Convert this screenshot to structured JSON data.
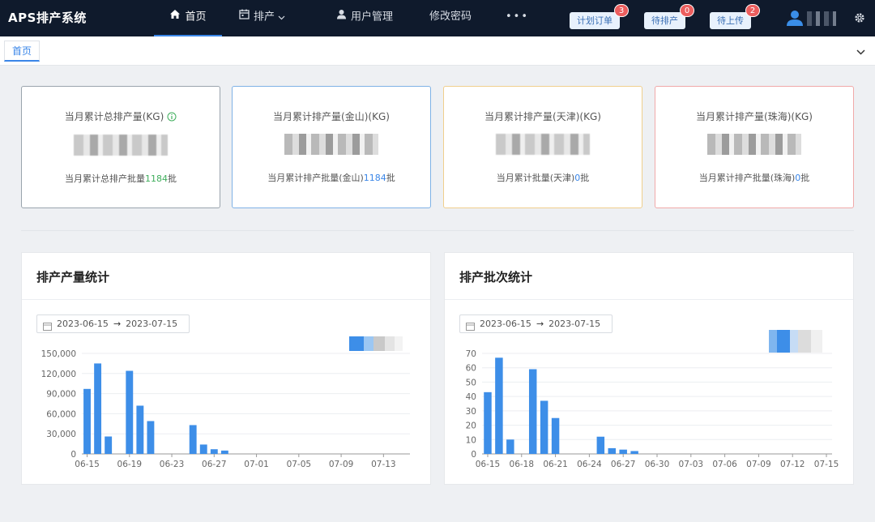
{
  "app": {
    "title": "APS排产系统",
    "nav": [
      {
        "label": "首页",
        "icon": "home-icon",
        "active": true
      },
      {
        "label": "排产",
        "icon": "calendar-icon"
      },
      {
        "label": "用户管理",
        "icon": "user-icon"
      },
      {
        "label": "修改密码"
      },
      {
        "label": "•••"
      }
    ],
    "quick_actions": [
      {
        "label": "计划订单",
        "badge": "3"
      },
      {
        "label": "待排产",
        "badge": "0"
      },
      {
        "label": "待上传",
        "badge": "2"
      }
    ]
  },
  "tabs": {
    "active": "首页"
  },
  "cards": [
    {
      "title": "当月累计总排产量(KG)",
      "foot_prefix": "当月累计总排产批量",
      "foot_value": "1184",
      "foot_suffix": "批",
      "accent": "#9aa4ad"
    },
    {
      "title": "当月累计排产量(金山)(KG)",
      "foot_prefix": "当月累计排产批量(金山)",
      "foot_value": "1184",
      "foot_suffix": "批",
      "accent": "#7fb2e6"
    },
    {
      "title": "当月累计排产量(天津)(KG)",
      "foot_prefix": "当月累计批量(天津)",
      "foot_value": "0",
      "foot_suffix": "批",
      "accent": "#f0cf8d"
    },
    {
      "title": "当月累计排产量(珠海)(KG)",
      "foot_prefix": "当月累计排产批量(珠海)",
      "foot_value": "0",
      "foot_suffix": "批",
      "accent": "#f0a9a9"
    }
  ],
  "panels": [
    {
      "title": "排产产量统计",
      "range_start": "2023-06-15",
      "range_arrow": "→",
      "range_end": "2023-07-15"
    },
    {
      "title": "排产批次统计",
      "range_start": "2023-06-15",
      "range_arrow": "→",
      "range_end": "2023-07-15"
    }
  ],
  "chart_data": [
    {
      "type": "bar",
      "title": "排产产量统计",
      "bar_color": "#3d8ee8",
      "ylim": [
        0,
        150000
      ],
      "ytick_values": [
        0,
        30000,
        60000,
        90000,
        120000,
        150000
      ],
      "ytick_labels": [
        "0",
        "30,000",
        "60,000",
        "90,000",
        "120,000",
        "150,000"
      ],
      "xtick_labels": [
        "06-15",
        "06-19",
        "06-23",
        "06-27",
        "07-01",
        "07-05",
        "07-09",
        "07-13"
      ],
      "categories": [
        "06-15",
        "06-16",
        "06-17",
        "06-18",
        "06-19",
        "06-20",
        "06-21",
        "06-22",
        "06-23",
        "06-24",
        "06-25",
        "06-26",
        "06-27",
        "06-28",
        "06-29",
        "06-30",
        "07-01",
        "07-02",
        "07-03",
        "07-04",
        "07-05",
        "07-06",
        "07-07",
        "07-08",
        "07-09",
        "07-10",
        "07-11",
        "07-12",
        "07-13",
        "07-14",
        "07-15"
      ],
      "values": [
        97000,
        135000,
        26000,
        0,
        124000,
        72000,
        49000,
        0,
        0,
        0,
        43000,
        14000,
        7000,
        5000,
        0,
        0,
        0,
        0,
        0,
        0,
        0,
        0,
        0,
        0,
        0,
        0,
        0,
        0,
        0,
        0,
        0
      ]
    },
    {
      "type": "bar",
      "title": "排产批次统计",
      "bar_color": "#3d8ee8",
      "ylim": [
        0,
        70
      ],
      "ytick_values": [
        0,
        10,
        20,
        30,
        40,
        50,
        60,
        70
      ],
      "ytick_labels": [
        "0",
        "10",
        "20",
        "30",
        "40",
        "50",
        "60",
        "70"
      ],
      "xtick_labels": [
        "06-15",
        "06-18",
        "06-21",
        "06-24",
        "06-27",
        "06-30",
        "07-03",
        "07-06",
        "07-09",
        "07-12",
        "07-15"
      ],
      "categories": [
        "06-15",
        "06-16",
        "06-17",
        "06-18",
        "06-19",
        "06-20",
        "06-21",
        "06-22",
        "06-23",
        "06-24",
        "06-25",
        "06-26",
        "06-27",
        "06-28",
        "06-29",
        "06-30",
        "07-01",
        "07-02",
        "07-03",
        "07-04",
        "07-05",
        "07-06",
        "07-07",
        "07-08",
        "07-09",
        "07-10",
        "07-11",
        "07-12",
        "07-13",
        "07-14",
        "07-15"
      ],
      "values": [
        43,
        67,
        10,
        0,
        59,
        37,
        25,
        0,
        0,
        0,
        12,
        4,
        3,
        2,
        0,
        0,
        0,
        0,
        0,
        0,
        0,
        0,
        0,
        0,
        0,
        0,
        0,
        0,
        0,
        0,
        0
      ]
    }
  ]
}
